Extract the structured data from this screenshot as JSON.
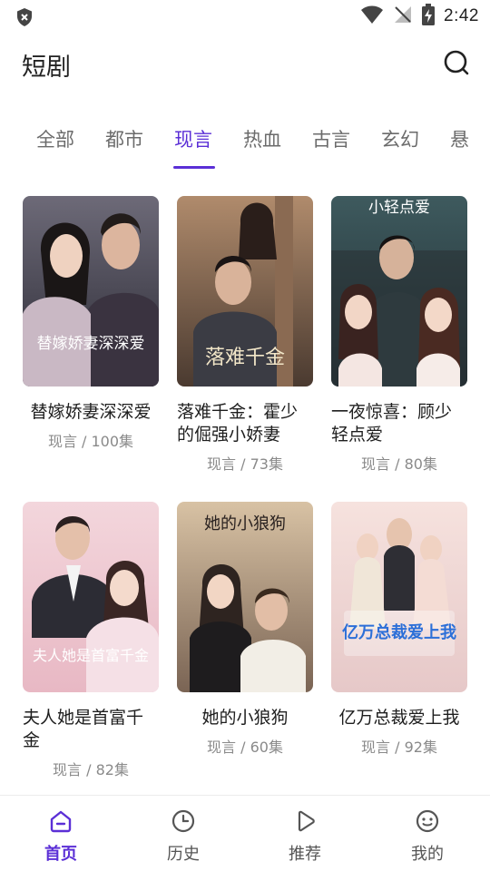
{
  "status_bar": {
    "time": "2:42",
    "icons": [
      "shield-icon",
      "wifi-icon",
      "no-signal-icon",
      "battery-charging-icon"
    ]
  },
  "header": {
    "title": "短剧",
    "search_icon": "search-icon"
  },
  "tabs": [
    {
      "label": "全部",
      "active": false
    },
    {
      "label": "都市",
      "active": false
    },
    {
      "label": "现言",
      "active": true
    },
    {
      "label": "热血",
      "active": false
    },
    {
      "label": "古言",
      "active": false
    },
    {
      "label": "玄幻",
      "active": false
    },
    {
      "label": "悬",
      "active": false
    }
  ],
  "accent_color": "#5b2fd6",
  "dramas": [
    {
      "title": "替嫁娇妻深深爱",
      "meta": "现言 / 100集",
      "poster_text": "替嫁娇妻深深爱"
    },
    {
      "title": "落难千金：霍少的倔强小娇妻",
      "meta": "现言 / 73集",
      "poster_text": "落难千金"
    },
    {
      "title": "一夜惊喜：顾少轻点爱",
      "meta": "现言 / 80集",
      "poster_text": "小轻点爱"
    },
    {
      "title": "夫人她是首富千金",
      "meta": "现言 / 82集",
      "poster_text": "夫人她是首富千金"
    },
    {
      "title": "她的小狼狗",
      "meta": "现言 / 60集",
      "poster_text": "她的小狼狗"
    },
    {
      "title": "亿万总裁爱上我",
      "meta": "现言 / 92集",
      "poster_text": "亿万总裁爱上我"
    }
  ],
  "bottom_nav": [
    {
      "label": "首页",
      "icon": "home-icon",
      "active": true
    },
    {
      "label": "历史",
      "icon": "clock-icon",
      "active": false
    },
    {
      "label": "推荐",
      "icon": "play-icon",
      "active": false
    },
    {
      "label": "我的",
      "icon": "smile-icon",
      "active": false
    }
  ]
}
